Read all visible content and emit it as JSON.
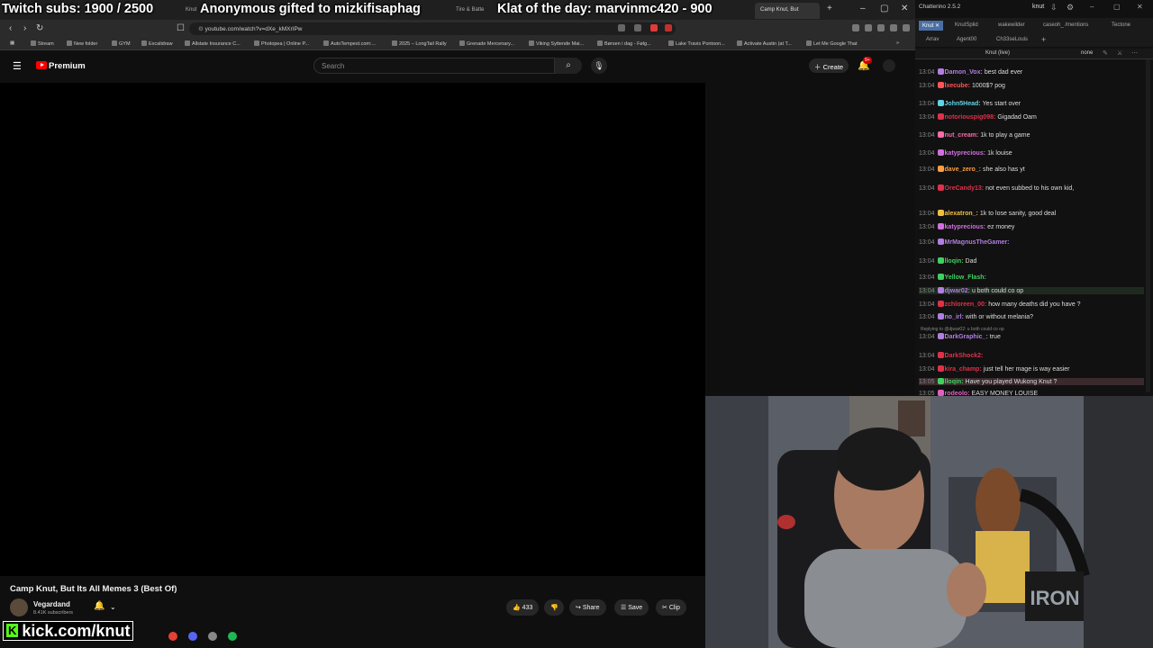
{
  "overlay": {
    "subs_goal": "Twitch subs: 1900 / 2500",
    "gift_message": "Anonymous gifted to mizkifisaphag",
    "klat": "Klat of the day: marvinmc420 - 900",
    "kick_prefix": "K",
    "kick_url": "kick.com/knut"
  },
  "browser": {
    "active_tab": "Camp Knut, But",
    "tabs": [
      "Knut",
      "Tire & Batte",
      "Camp Knut, But"
    ],
    "url": "youtube.com/watch?v=dXe_kMXrIPw",
    "bookmarks": [
      "Stream",
      "New folder",
      "GYM",
      "Excalidraw",
      "Allstate Insurance C...",
      "Photopea | Online P...",
      "AutoTempest.com:...",
      "2025 – LongTail Rally",
      "Grenade Mercenary...",
      "Viking Syttende Mai...",
      "Børsen i dag - Følg...",
      "Lake Travis Pontoon...",
      "Activate Austin (at T...",
      "Let Me Google That"
    ]
  },
  "youtube": {
    "logo": "Premium",
    "search_placeholder": "Search",
    "create": "Create",
    "notif_count": "9+",
    "video_title": "Camp Knut, But Its All Memes 3 (Best Of)",
    "channel": "Vegardand",
    "subscribers": "8.41K subscribers",
    "likes": "433",
    "share": "Share",
    "save": "Save",
    "clip": "Clip"
  },
  "chatterino": {
    "title": "Chatterino 2.5.2",
    "user": "knut",
    "tabs_row1": [
      "Knut",
      "KnutSplid",
      "wakewilder",
      "caseoh_ /mentions",
      "Tectone"
    ],
    "tabs_row2": [
      "Arrav",
      "Agent00",
      "Ch33seLouis"
    ],
    "split_name": "Knut (live)",
    "split_mode": "none",
    "messages": [
      {
        "time": "13:04",
        "user": "Damon_Vox:",
        "text": "best dad ever",
        "color": "#b07fe0"
      },
      {
        "time": "13:04",
        "user": "lxecube:",
        "text": "1000$? pog",
        "color": "#ff5555"
      },
      {
        "time": "13:04",
        "user": "John5Head:",
        "text": "Yes start over",
        "color": "#5fd4e8"
      },
      {
        "time": "13:04",
        "user": "notoriouspig098:",
        "text": "Gigadad Oam",
        "color": "#e0304a"
      },
      {
        "time": "13:04",
        "user": "nut_cream:",
        "text": "1k to play a game",
        "color": "#ff6aa8"
      },
      {
        "time": "13:04",
        "user": "katyprecious:",
        "text": "1k louise",
        "color": "#d070e0"
      },
      {
        "time": "13:04",
        "user": "dave_zero_:",
        "text": "she also has yt",
        "color": "#ff9f40"
      },
      {
        "time": "13:04",
        "user": "OreCandy13:",
        "text": "not even subbed to his own kid,",
        "color": "#e0304a"
      },
      {
        "time": "13:04",
        "user": "alexatron_:",
        "text": "1k to lose sanity, good deal",
        "color": "#f0c040"
      },
      {
        "time": "13:04",
        "user": "katyprecious:",
        "text": "ez money",
        "color": "#d070e0"
      },
      {
        "time": "13:04",
        "user": "MrMagnusTheGamer:",
        "text": "",
        "color": "#b07fe0"
      },
      {
        "time": "13:04",
        "user": "lloqin:",
        "text": "Dad",
        "color": "#40d060"
      },
      {
        "time": "13:04",
        "user": "Yellow_Flash:",
        "text": "",
        "color": "#40d060"
      },
      {
        "time": "13:04",
        "user": "djwar02:",
        "text": "u both could co op",
        "color": "#b07fe0"
      },
      {
        "time": "13:04",
        "user": "zchloreen_00:",
        "text": "how many deaths did you have ?",
        "color": "#e0304a"
      },
      {
        "time": "13:04",
        "user": "no_irl:",
        "text": "with or without melania?",
        "color": "#b07fe0"
      },
      {
        "time": "13:04",
        "user": "DarkGraphic_:",
        "text": "true",
        "color": "#b07fe0"
      },
      {
        "time": "13:04",
        "user": "DarkShock2:",
        "text": "",
        "color": "#e0304a"
      },
      {
        "time": "13:04",
        "user": "kira_champ:",
        "text": "just tell her mage is way easier",
        "color": "#e0304a"
      },
      {
        "time": "13:05",
        "user": "lloqin:",
        "text": "Have you played Wukong Knut ?",
        "color": "#40d060"
      },
      {
        "time": "13:05",
        "user": "rodeolo:",
        "text": "EASY MONEY LOUISE",
        "color": "#e060c0"
      }
    ],
    "reply_text": "Replying to @djwar02: u both could co op"
  }
}
